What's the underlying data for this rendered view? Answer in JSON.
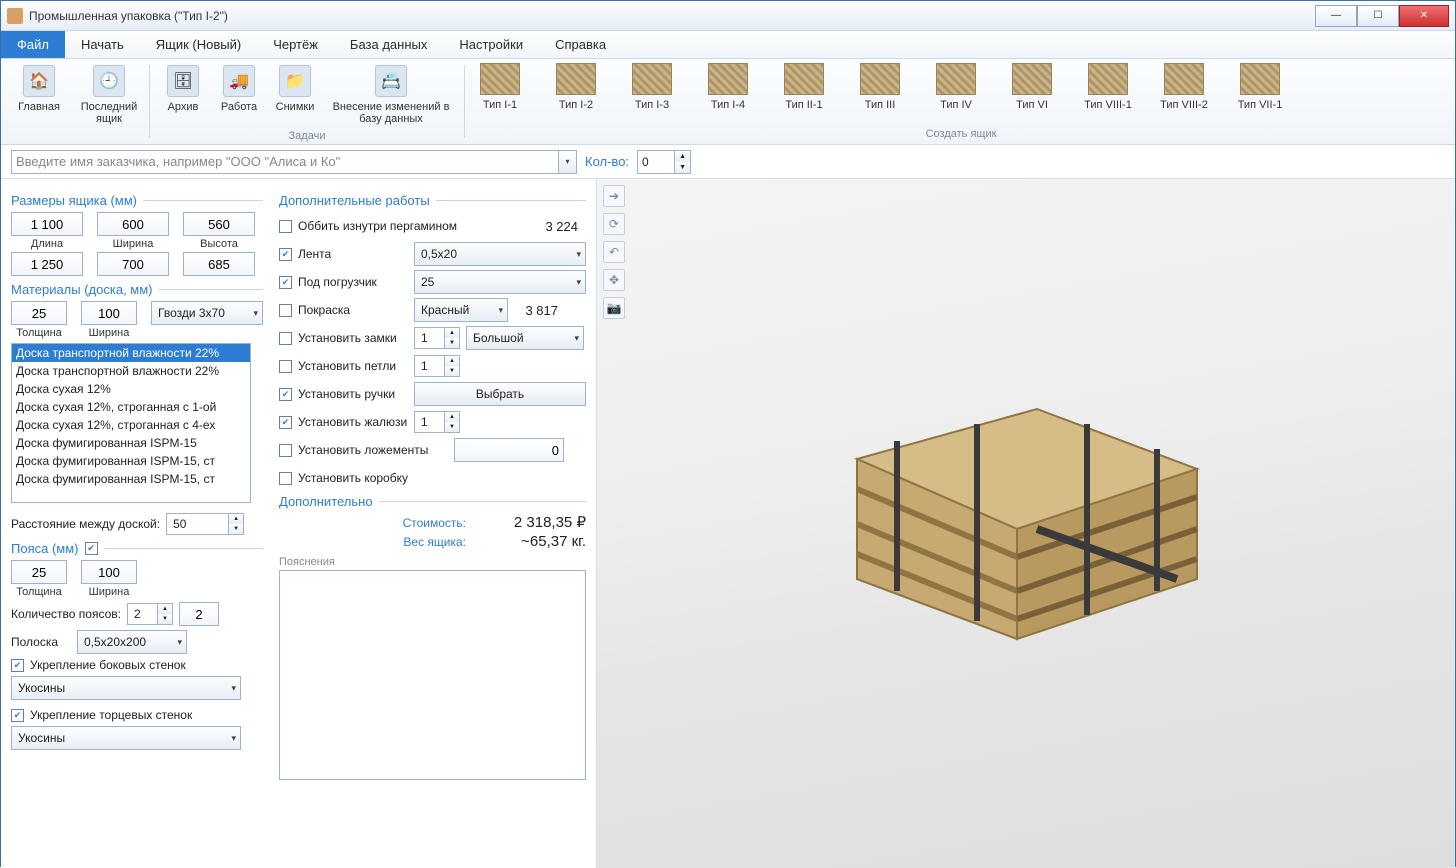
{
  "window": {
    "title": "Промышленная упаковка (\"Тип I-2\")"
  },
  "menu": {
    "file": "Файл",
    "start": "Начать",
    "box": "Ящик (Новый)",
    "drawing": "Чертёж",
    "db": "База данных",
    "settings": "Настройки",
    "help": "Справка"
  },
  "ribbon": {
    "home": "Главная",
    "last": "Последний ящик",
    "archive": "Архив",
    "work": "Работа",
    "snaps": "Снимки",
    "dbedit": "Внесение изменений в базу данных",
    "tasks_group": "Задачи",
    "create_group": "Создать ящик",
    "types": [
      "Тип I-1",
      "Тип I-2",
      "Тип I-3",
      "Тип I-4",
      "Тип II-1",
      "Тип III",
      "Тип IV",
      "Тип VI",
      "Тип VIII-1",
      "Тип VIII-2",
      "Тип VII-1"
    ]
  },
  "search": {
    "placeholder": "Введите имя заказчика, например \"ООО \"Алиса и Ко\"",
    "qty_label": "Кол-во:",
    "qty": "0"
  },
  "dims": {
    "title": "Размеры ящика (мм)",
    "length": "1 100",
    "width": "600",
    "height": "560",
    "length_lbl": "Длина",
    "width_lbl": "Ширина",
    "height_lbl": "Высота",
    "length2": "1 250",
    "width2": "700",
    "height2": "685"
  },
  "materials": {
    "title": "Материалы (доска, мм)",
    "thickness": "25",
    "width": "100",
    "nails": "Гвозди 3x70",
    "thickness_lbl": "Толщина",
    "width_lbl": "Ширина",
    "list": [
      "Доска транспортной влажности 22%",
      "Доска транспортной влажности 22%",
      "Доска сухая 12%",
      "Доска сухая 12%, строганная с 1-ой",
      "Доска сухая 12%, строганная с 4-ех",
      "Доска фумигированная ISPM-15",
      "Доска фумигированная ISPM-15, ст",
      "Доска фумигированная ISPM-15, ст"
    ],
    "spacing_lbl": "Расстояние между доской:",
    "spacing": "50"
  },
  "belts": {
    "title": "Пояса (мм)",
    "thickness": "25",
    "width": "100",
    "thickness_lbl": "Толщина",
    "width_lbl": "Ширина",
    "count_lbl": "Количество поясов:",
    "count1": "2",
    "count2": "2",
    "strip_lbl": "Полоска",
    "strip": "0,5x20x200",
    "side_lbl": "Укрепление боковых стенок",
    "side_val": "Укосины",
    "end_lbl": "Укрепление торцевых стенок",
    "end_val": "Укосины"
  },
  "extra": {
    "title": "Дополнительные работы",
    "pergamin": "Оббить изнутри пергамином",
    "pergamin_cost": "3 224",
    "tape": "Лента",
    "tape_val": "0,5x20",
    "forklift": "Под погрузчик",
    "forklift_val": "25",
    "paint": "Покраска",
    "paint_val": "Красный",
    "paint_cost": "3 817",
    "locks": "Установить замки",
    "locks_n": "1",
    "locks_size": "Большой",
    "hinges": "Установить петли",
    "hinges_n": "1",
    "handles": "Установить ручки",
    "handles_btn": "Выбрать",
    "blinds": "Установить жалюзи",
    "blinds_n": "1",
    "cradles": "Установить ложементы",
    "cradles_n": "0",
    "innerbox": "Установить коробку",
    "more": "Дополнительно",
    "cost_lbl": "Стоимость:",
    "cost": "2 318,35 ₽",
    "weight_lbl": "Вес ящика:",
    "weight": "~65,37 кг.",
    "notes_lbl": "Пояснения"
  }
}
